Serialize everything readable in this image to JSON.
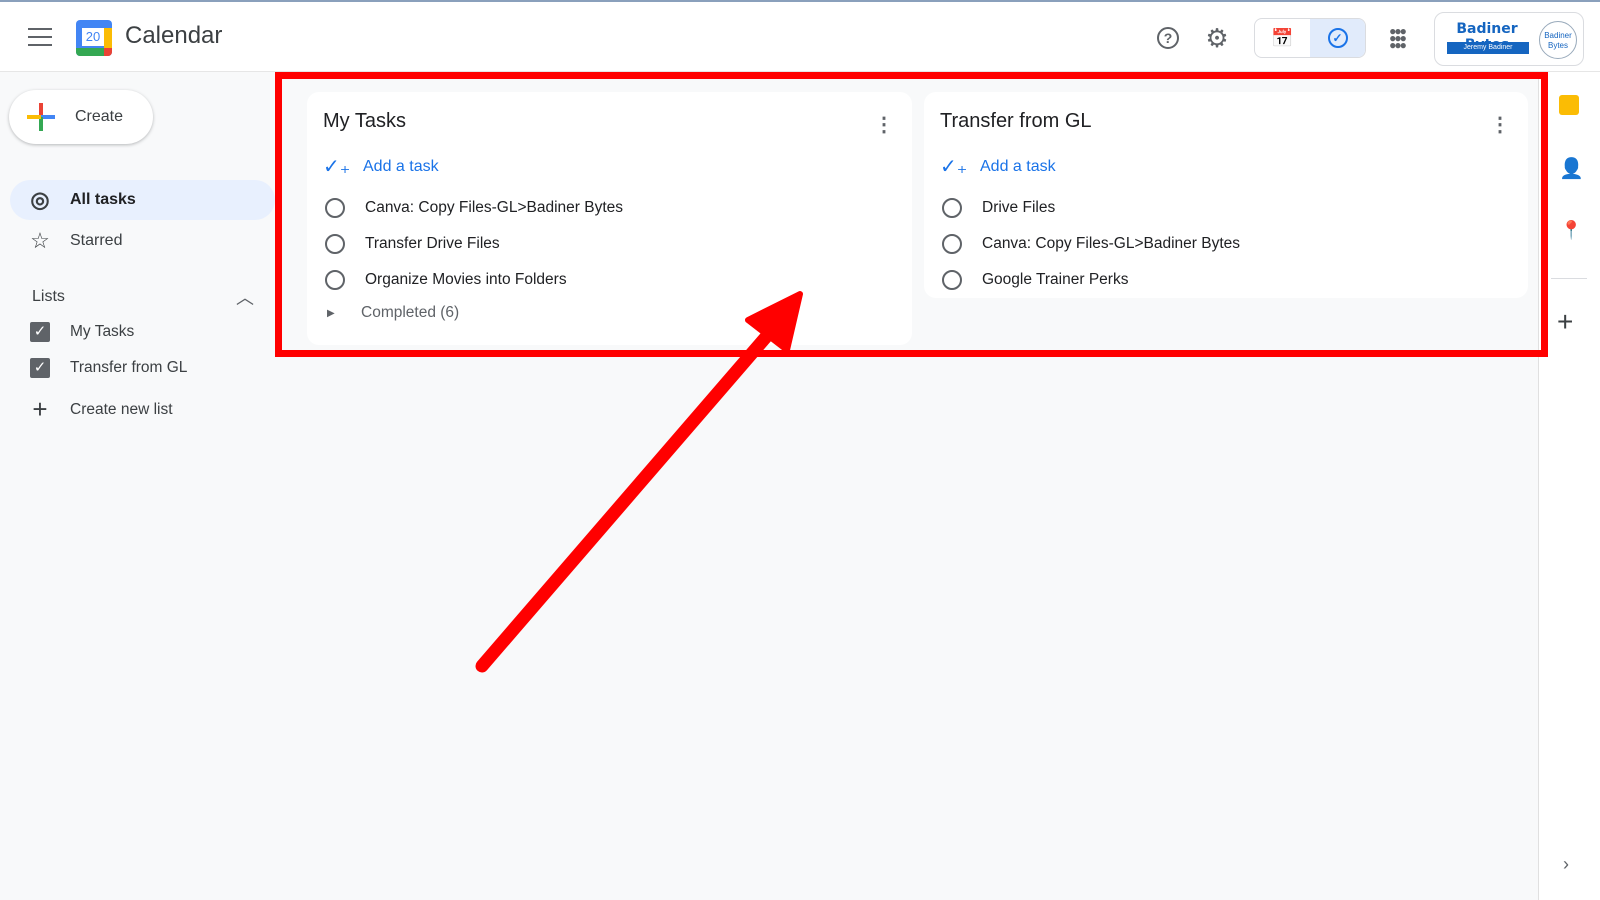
{
  "header": {
    "app_title": "Calendar",
    "logo_day": "20",
    "brand_name": "Badiner Bytes",
    "brand_owner": "Jeremy Badiner",
    "avatar_text": "Badiner Bytes"
  },
  "sidebar": {
    "create_label": "Create",
    "nav": [
      {
        "label": "All tasks",
        "selected": true
      },
      {
        "label": "Starred"
      }
    ],
    "lists_heading": "Lists",
    "lists": [
      {
        "label": "My Tasks",
        "checked": true
      },
      {
        "label": "Transfer from GL",
        "checked": true
      }
    ],
    "create_list_label": "Create new list"
  },
  "lists": [
    {
      "title": "My Tasks",
      "add_label": "Add a task",
      "tasks": [
        "Canva: Copy Files-GL>Badiner Bytes",
        "Transfer Drive Files",
        "Organize Movies into Folders"
      ],
      "completed_label": "Completed (6)"
    },
    {
      "title": "Transfer from GL",
      "add_label": "Add a task",
      "tasks": [
        "Drive Files",
        "Canva: Copy Files-GL>Badiner Bytes",
        "Google Trainer Perks"
      ]
    }
  ],
  "colors": {
    "accent": "#1a73e8",
    "annotation": "#ff0000"
  }
}
